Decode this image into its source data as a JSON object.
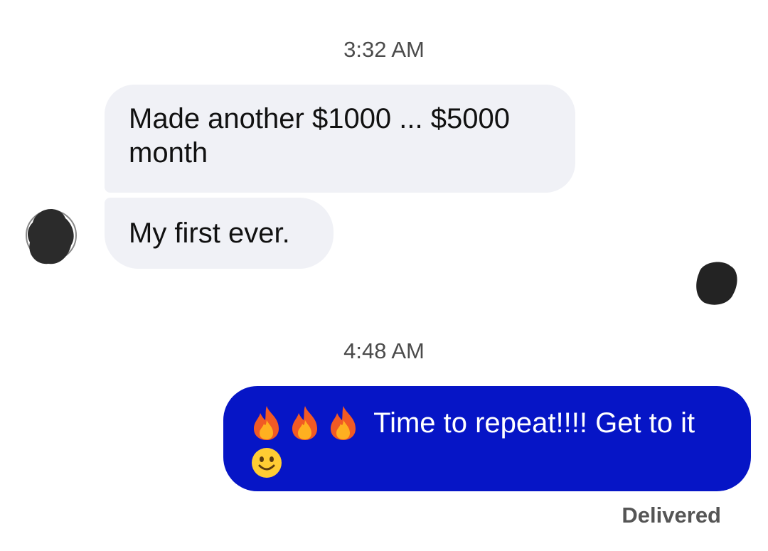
{
  "conversation": {
    "timestamp_1": "3:32 AM",
    "incoming_message_1_line_1": "Made another $1000 ... $5000",
    "incoming_message_1_line_2": "month",
    "incoming_message_2": "My first ever.",
    "timestamp_2": "4:48 AM",
    "outgoing_message_text": "Time to repeat!!!! Get to it",
    "outgoing_emojis_leading": [
      "fire-icon",
      "fire-icon",
      "fire-icon"
    ],
    "outgoing_emoji_trailing": "smiling-face-icon",
    "status": "Delivered"
  },
  "colors": {
    "incoming_bubble": "#f0f1f6",
    "outgoing_bubble": "#0615c6",
    "timestamp_text": "#4b4b4b"
  }
}
